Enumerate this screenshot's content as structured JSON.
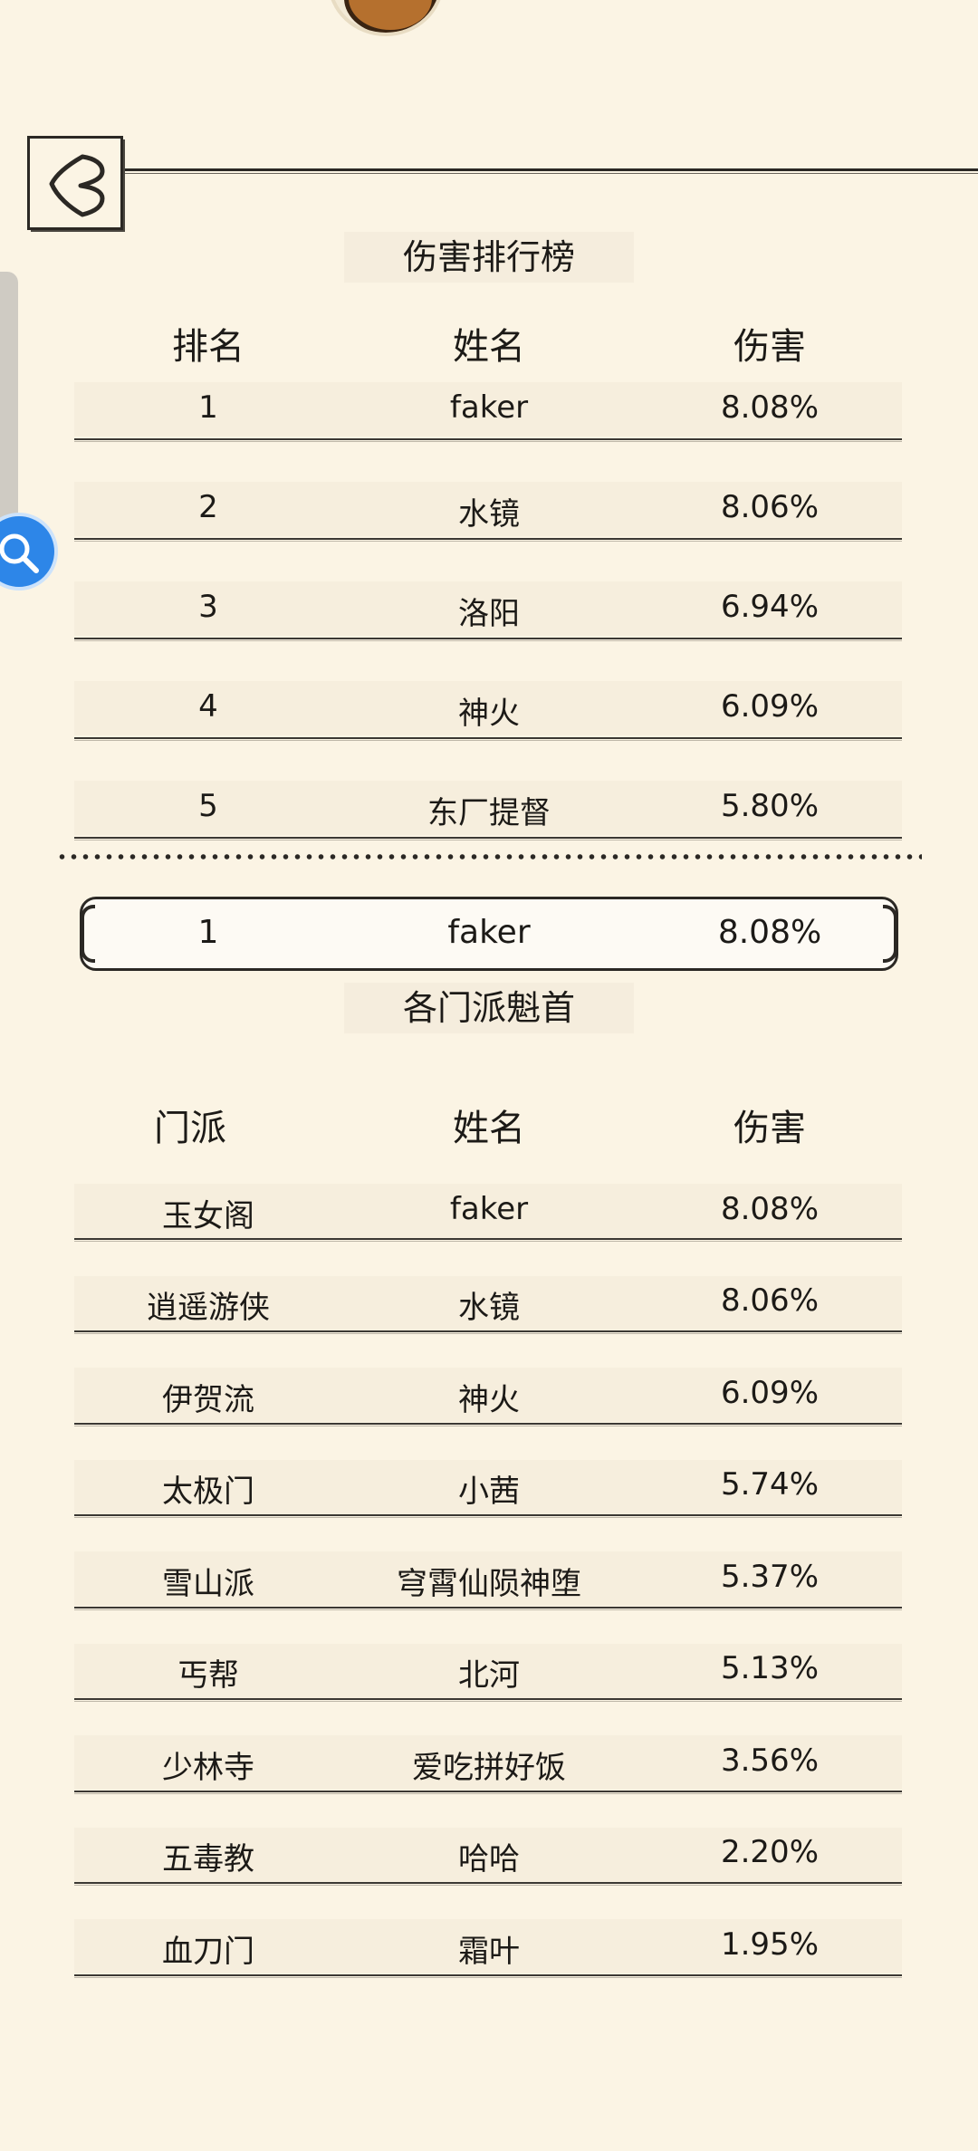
{
  "damage_ranking": {
    "title": "伤害排行榜",
    "headers": {
      "rank": "排名",
      "name": "姓名",
      "damage": "伤害"
    },
    "rows": [
      {
        "rank": "1",
        "name": "faker",
        "damage": "8.08%"
      },
      {
        "rank": "2",
        "name": "水镜",
        "damage": "8.06%"
      },
      {
        "rank": "3",
        "name": "洛阳",
        "damage": "6.94%"
      },
      {
        "rank": "4",
        "name": "神火",
        "damage": "6.09%"
      },
      {
        "rank": "5",
        "name": "东厂提督",
        "damage": "5.80%"
      }
    ],
    "my_row": {
      "rank": "1",
      "name": "faker",
      "damage": "8.08%"
    }
  },
  "sect_leaders": {
    "title": "各门派魁首",
    "headers": {
      "sect": "门派",
      "name": "姓名",
      "damage": "伤害"
    },
    "rows": [
      {
        "sect": "玉女阁",
        "name": "faker",
        "damage": "8.08%"
      },
      {
        "sect": "逍遥游侠",
        "name": "水镜",
        "damage": "8.06%"
      },
      {
        "sect": "伊贺流",
        "name": "神火",
        "damage": "6.09%"
      },
      {
        "sect": "太极门",
        "name": "小茜",
        "damage": "5.74%"
      },
      {
        "sect": "雪山派",
        "name": "穹霄仙陨神堕",
        "damage": "5.37%"
      },
      {
        "sect": "丐帮",
        "name": "北河",
        "damage": "5.13%"
      },
      {
        "sect": "少林寺",
        "name": "爱吃拼好饭",
        "damage": "3.56%"
      },
      {
        "sect": "五毒教",
        "name": "哈哈",
        "damage": "2.20%"
      },
      {
        "sect": "血刀门",
        "name": "霜叶",
        "damage": "1.95%"
      }
    ]
  },
  "icons": {
    "back": "back-chevron-icon",
    "search": "search-icon",
    "avatar": "avatar-icon"
  },
  "colors": {
    "background": "#fbf4e4",
    "ink": "#1c1a17",
    "search_bubble": "#2d86e8"
  }
}
